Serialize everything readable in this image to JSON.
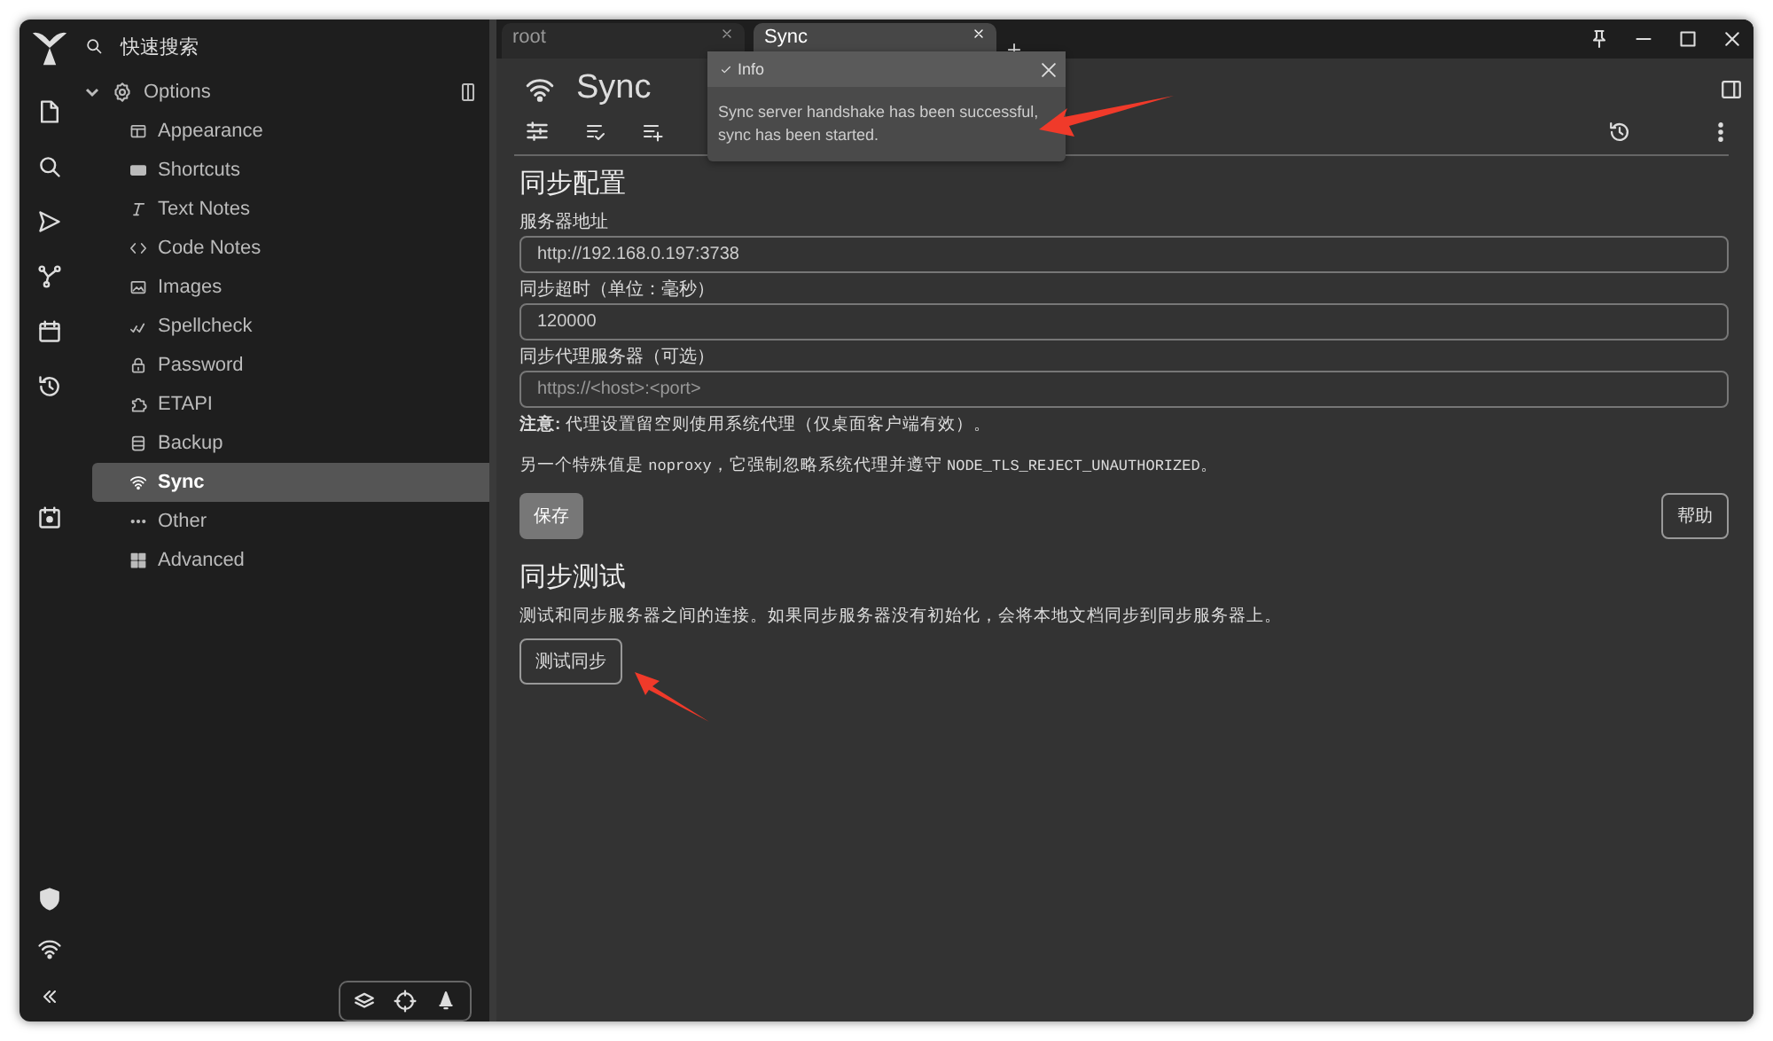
{
  "quick_search": {
    "label": "快速搜索"
  },
  "tree": {
    "label": "Options",
    "expanded": true,
    "children": [
      {
        "label": "Appearance",
        "selected": false
      },
      {
        "label": "Shortcuts",
        "selected": false
      },
      {
        "label": "Text Notes",
        "selected": false
      },
      {
        "label": "Code Notes",
        "selected": false
      },
      {
        "label": "Images",
        "selected": false
      },
      {
        "label": "Spellcheck",
        "selected": false
      },
      {
        "label": "Password",
        "selected": false
      },
      {
        "label": "ETAPI",
        "selected": false
      },
      {
        "label": "Backup",
        "selected": false
      },
      {
        "label": "Sync",
        "selected": true
      },
      {
        "label": "Other",
        "selected": false
      },
      {
        "label": "Advanced",
        "selected": false
      }
    ]
  },
  "tabs": [
    {
      "label": "root",
      "selected": false
    },
    {
      "label": "Sync",
      "selected": true
    }
  ],
  "toast": {
    "title": "Info",
    "message": "Sync server handshake has been successful, sync has been started."
  },
  "note": {
    "title": "Sync"
  },
  "sync_config": {
    "title": "同步配置",
    "fields": [
      {
        "label": "服务器地址",
        "value": "http://192.168.0.197:3738"
      },
      {
        "label": "同步超时（单位：毫秒）",
        "value": "120000"
      },
      {
        "label": "同步代理服务器（可选）",
        "placeholder": "https://<host>:<port>"
      }
    ],
    "note": "**注意:** 代理设置留空则使用系统代理（仅桌面客户端有效）。",
    "special": [
      {
        "kind": "text",
        "text": "另一个特殊值是 "
      },
      {
        "kind": "code",
        "text": "noproxy"
      },
      {
        "kind": "text",
        "text": "，它强制忽略系统代理并遵守 "
      },
      {
        "kind": "code",
        "text": "NODE_TLS_REJECT_UNAUTHORIZED"
      },
      {
        "kind": "text",
        "text": "。"
      }
    ],
    "save_button": "保存",
    "help_button": "帮助"
  },
  "sync_test": {
    "title": "同步测试",
    "description": "测试和同步服务器之间的连接。如果同步服务器没有初始化，会将本地文档同步到同步服务器上。",
    "button": "测试同步"
  }
}
